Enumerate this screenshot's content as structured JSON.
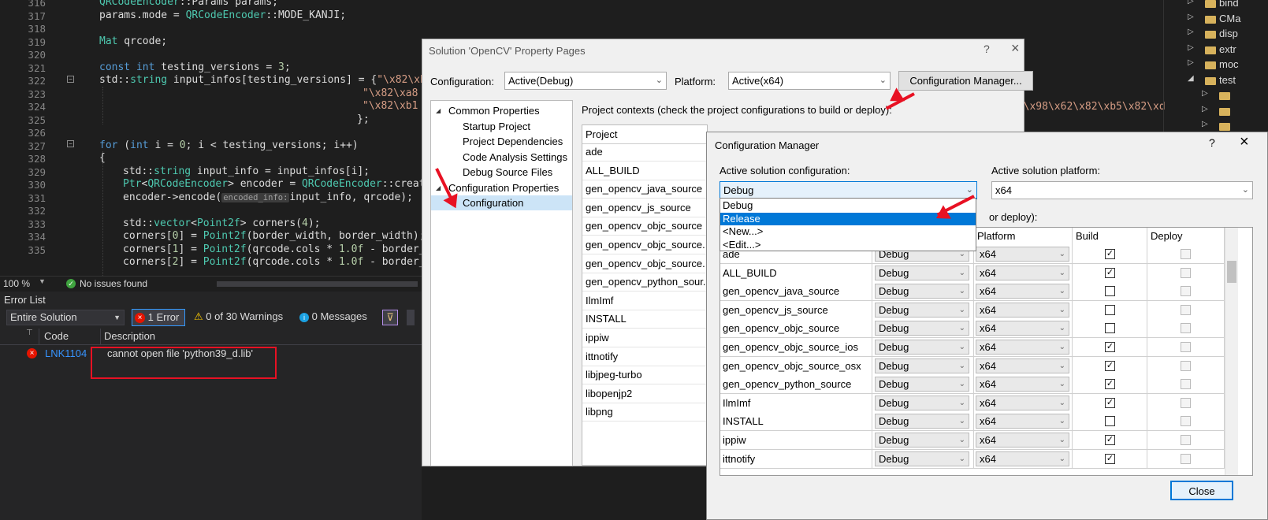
{
  "editor": {
    "line_numbers": [
      "316",
      "317",
      "318",
      "319",
      "320",
      "321",
      "322",
      "323",
      "324",
      "325",
      "326",
      "327",
      "328",
      "329",
      "330",
      "331",
      "332",
      "333",
      "334",
      "335"
    ],
    "lines": [
      "QRCodeEncoder::Params params;",
      "params.mode = QRCodeEncoder::MODE_KANJI;",
      "",
      "Mat qrcode;",
      "",
      "const int testing_versions = 3;",
      "std::string input_infos[testing_versions] = {\"\\x82\\xb1",
      "\"\\x82\\xa8",
      "\"\\x82\\xb1",
      "};",
      "",
      "for (int i = 0; i < testing_versions; i++)",
      "{",
      "std::string input_info = input_infos[i];",
      "Ptr<QRCodeEncoder> encoder = QRCodeEncoder::create",
      "encoder->encode(input_info, qrcode);",
      "",
      "std::vector<Point2f> corners(4);",
      "corners[0] = Point2f(border_width, border_width);",
      "corners[1] = Point2f(qrcode.cols * 1.0f - border_w",
      "corners[2] = Point2f(qrcode.cols * 1.0f - border_w"
    ],
    "param_hint": "encoded_info:",
    "overflow_text": "F0\\x98\\x62\\x82\\xb5\\x82\\xd"
  },
  "status": {
    "zoom": "100 %",
    "issues": "No issues found"
  },
  "error_list": {
    "title": "Error List",
    "scope": "Entire Solution",
    "errors_btn": "1 Error",
    "warnings_btn": "0 of 30 Warnings",
    "messages_btn": "0 Messages",
    "col_code": "Code",
    "col_description": "Description",
    "rows": [
      {
        "code": "LNK1104",
        "description": "cannot open file 'python39_d.lib'"
      }
    ]
  },
  "tree": {
    "items": [
      "bind",
      "CMa",
      "disp",
      "extr",
      "moc",
      "test",
      "",
      "",
      ""
    ]
  },
  "property_pages": {
    "title": "Solution 'OpenCV' Property Pages",
    "help": "?",
    "close": "×",
    "configuration_label": "Configuration:",
    "configuration_value": "Active(Debug)",
    "platform_label": "Platform:",
    "platform_value": "Active(x64)",
    "config_manager_btn": "Configuration Manager...",
    "nav": [
      {
        "label": "Common Properties",
        "level": 0,
        "expander": "◢"
      },
      {
        "label": "Startup Project",
        "level": 1
      },
      {
        "label": "Project Dependencies",
        "level": 1
      },
      {
        "label": "Code Analysis Settings",
        "level": 1
      },
      {
        "label": "Debug Source Files",
        "level": 1
      },
      {
        "label": "Configuration Properties",
        "level": 0,
        "expander": "◢"
      },
      {
        "label": "Configuration",
        "level": 1
      }
    ],
    "contexts_label": "Project contexts (check the project configurations to build or deploy):",
    "col_project": "Project",
    "projects": [
      "ade",
      "ALL_BUILD",
      "gen_opencv_java_source",
      "gen_opencv_js_source",
      "gen_opencv_objc_source",
      "gen_opencv_objc_source...",
      "gen_opencv_objc_source...",
      "gen_opencv_python_sour...",
      "IlmImf",
      "INSTALL",
      "ippiw",
      "ittnotify",
      "libjpeg-turbo",
      "libopenjp2",
      "libpng"
    ]
  },
  "config_manager": {
    "title": "Configuration Manager",
    "help": "?",
    "close": "×",
    "active_config_label": "Active solution configuration:",
    "active_config_value": "Debug",
    "active_platform_label": "Active solution platform:",
    "active_platform_value": "x64",
    "dropdown_options": [
      "Debug",
      "Release",
      "<New...>",
      "<Edit...>"
    ],
    "dropdown_highlighted": "Release",
    "contexts_partial": "or deploy):",
    "col_platform": "Platform",
    "col_build": "Build",
    "col_deploy": "Deploy",
    "rows": [
      {
        "project": "ade",
        "config": "Debug",
        "platform": "x64",
        "build": true
      },
      {
        "project": "ALL_BUILD",
        "config": "Debug",
        "platform": "x64",
        "build": true
      },
      {
        "project": "gen_opencv_java_source",
        "config": "Debug",
        "platform": "x64",
        "build": false
      },
      {
        "project": "gen_opencv_js_source",
        "config": "Debug",
        "platform": "x64",
        "build": false
      },
      {
        "project": "gen_opencv_objc_source",
        "config": "Debug",
        "platform": "x64",
        "build": false
      },
      {
        "project": "gen_opencv_objc_source_ios",
        "config": "Debug",
        "platform": "x64",
        "build": true
      },
      {
        "project": "gen_opencv_objc_source_osx",
        "config": "Debug",
        "platform": "x64",
        "build": true
      },
      {
        "project": "gen_opencv_python_source",
        "config": "Debug",
        "platform": "x64",
        "build": true
      },
      {
        "project": "IlmImf",
        "config": "Debug",
        "platform": "x64",
        "build": true
      },
      {
        "project": "INSTALL",
        "config": "Debug",
        "platform": "x64",
        "build": false
      },
      {
        "project": "ippiw",
        "config": "Debug",
        "platform": "x64",
        "build": true
      },
      {
        "project": "ittnotify",
        "config": "Debug",
        "platform": "x64",
        "build": true
      }
    ],
    "close_btn": "Close"
  },
  "colors": {
    "accent_blue": "#0078d7",
    "annotation_red": "#e81123"
  }
}
